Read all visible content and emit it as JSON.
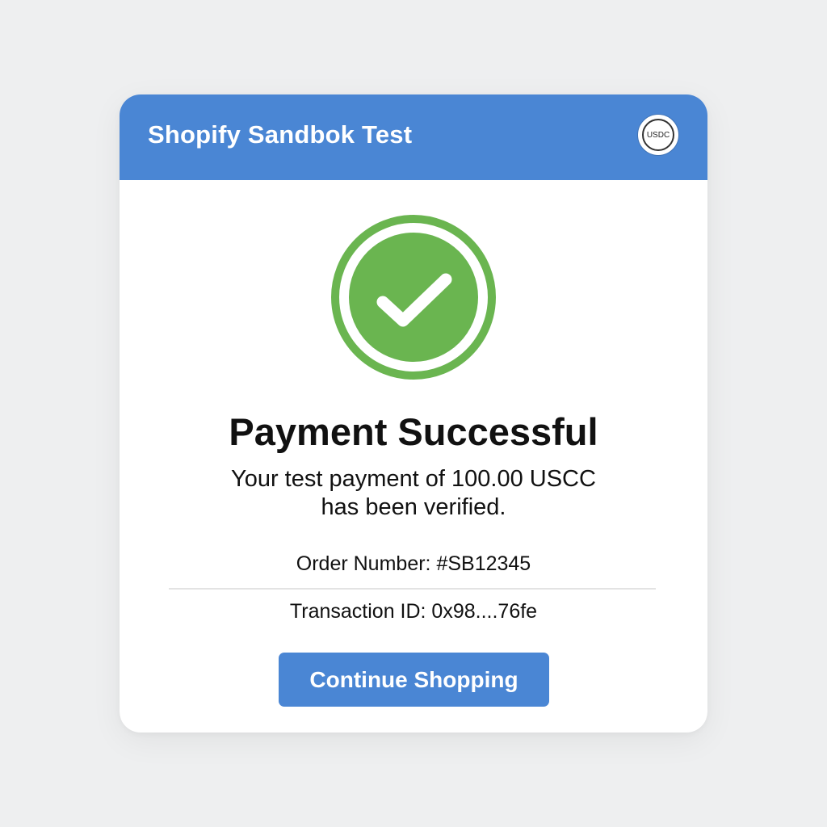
{
  "header": {
    "title": "Shopify Sandbok Test",
    "badge": "USDC"
  },
  "status": {
    "icon": "check-circle-icon",
    "title": "Payment Successful",
    "message_line1": "Your test payment of 100.00 USCC",
    "message_line2": "has been verified."
  },
  "details": {
    "order": "Order Number: #SB12345",
    "transaction": "Transaction ID: 0x98....76fe"
  },
  "actions": {
    "continue_label": "Continue Shopping"
  },
  "colors": {
    "header": "#4a86d4",
    "success_green": "#6ab550",
    "button": "#4a86d4",
    "background": "#eeeff0"
  }
}
